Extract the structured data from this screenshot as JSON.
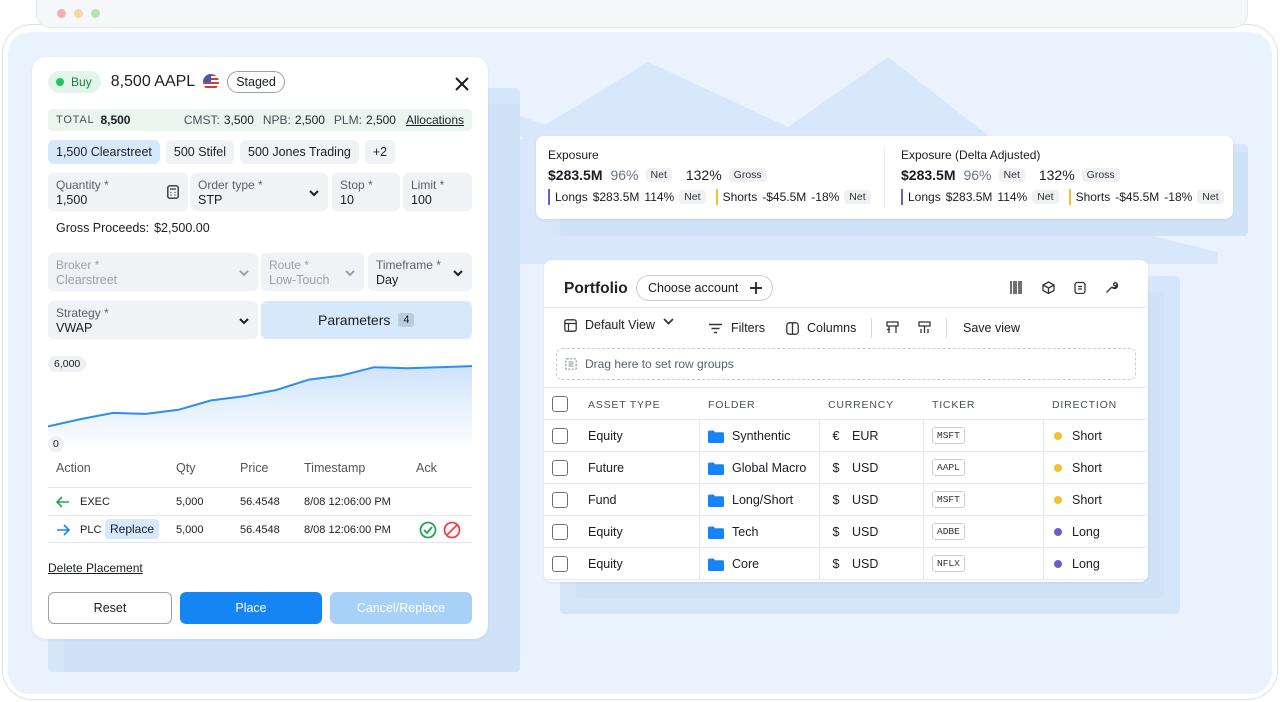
{
  "colors": {
    "accent": "#1685f4",
    "stage": "#eaf2fd",
    "green": "#22c55e",
    "red": "#ef4444",
    "long": "#6d5bd0",
    "short": "#f2c12e",
    "allocBg": "#e8f6ef"
  },
  "order": {
    "side": "Buy",
    "title": "8,500 AAPL",
    "status": "Staged",
    "total_label": "TOTAL",
    "total_value": "8,500",
    "allocs": [
      {
        "k": "CMST:",
        "v": "3,500"
      },
      {
        "k": "NPB:",
        "v": "2,500"
      },
      {
        "k": "PLM:",
        "v": "2,500"
      }
    ],
    "allocations_link": "Allocations",
    "brokers": [
      "1,500 Clearstreet",
      "500 Stifel",
      "500 Jones Trading",
      "+2"
    ],
    "quantity": {
      "label": "Quantity *",
      "value": "1,500"
    },
    "order_type": {
      "label": "Order type *",
      "value": "STP"
    },
    "stop": {
      "label": "Stop *",
      "value": "10"
    },
    "limit": {
      "label": "Limit *",
      "value": "100"
    },
    "gross_label": "Gross Proceeds:",
    "gross_value": "$2,500.00",
    "broker": {
      "label": "Broker *",
      "value": "Clearstreet"
    },
    "route": {
      "label": "Route *",
      "value": "Low-Touch"
    },
    "timeframe": {
      "label": "Timeframe *",
      "value": "Day"
    },
    "strategy": {
      "label": "Strategy *",
      "value": "VWAP"
    },
    "parameters_label": "Parameters",
    "parameters_count": "4",
    "chart_top": "6,000",
    "chart_bottom": "0",
    "exec_headers": [
      "Action",
      "Qty",
      "Price",
      "Timestamp",
      "Ack"
    ],
    "exec_rows": [
      {
        "action": "EXEC",
        "tag": "",
        "qty": "5,000",
        "price": "56.4548",
        "ts": "8/08 12:06:00 PM"
      },
      {
        "action": "PLC",
        "tag": "Replace",
        "qty": "5,000",
        "price": "56.4548",
        "ts": "8/08 12:06:00 PM"
      }
    ],
    "delete_link": "Delete Placement",
    "reset": "Reset",
    "place": "Place",
    "cancel_replace": "Cancel/Replace"
  },
  "chart_data": {
    "type": "area",
    "ylim": [
      0,
      6000
    ],
    "y_tick_labels": [
      "6,000",
      "0"
    ],
    "values": [
      1600,
      2300,
      2900,
      2800,
      3200,
      4100,
      4500,
      5100,
      6100,
      6500,
      7300,
      7200,
      7300,
      7400
    ]
  },
  "exposure": [
    {
      "title": "Exposure",
      "amount": "$283.5M",
      "pct": "96%",
      "net": "Net",
      "gross_pct": "132%",
      "gross": "Gross",
      "longs_label": "Longs",
      "longs_amt": "$283.5M",
      "longs_pct": "114%",
      "longs_tag": "Net",
      "shorts_label": "Shorts",
      "shorts_amt": "-$45.5M",
      "shorts_pct": "-18%",
      "shorts_tag": "Net"
    },
    {
      "title": "Exposure (Delta Adjusted)",
      "amount": "$283.5M",
      "pct": "96%",
      "net": "Net",
      "gross_pct": "132%",
      "gross": "Gross",
      "longs_label": "Longs",
      "longs_amt": "$283.5M",
      "longs_pct": "114%",
      "longs_tag": "Net",
      "shorts_label": "Shorts",
      "shorts_amt": "-$45.5M",
      "shorts_pct": "-18%",
      "shorts_tag": "Net"
    }
  ],
  "portfolio": {
    "title": "Portfolio",
    "choose_account": "Choose account",
    "default_view": "Default View",
    "filters": "Filters",
    "columns": "Columns",
    "save_view": "Save view",
    "drag_hint": "Drag here to set row groups",
    "headers": [
      "ASSET TYPE",
      "FOLDER",
      "CURRENCY",
      "TICKER",
      "DIRECTION"
    ],
    "rows": [
      {
        "asset": "Equity",
        "folder": "Synthentic",
        "cur_sym": "€",
        "cur": "EUR",
        "ticker": "MSFT",
        "dir": "Short"
      },
      {
        "asset": "Future",
        "folder": "Global Macro",
        "cur_sym": "$",
        "cur": "USD",
        "ticker": "AAPL",
        "dir": "Short"
      },
      {
        "asset": "Fund",
        "folder": "Long/Short",
        "cur_sym": "$",
        "cur": "USD",
        "ticker": "MSFT",
        "dir": "Short"
      },
      {
        "asset": "Equity",
        "folder": "Tech",
        "cur_sym": "$",
        "cur": "USD",
        "ticker": "ADBE",
        "dir": "Long"
      },
      {
        "asset": "Equity",
        "folder": "Core",
        "cur_sym": "$",
        "cur": "USD",
        "ticker": "NFLX",
        "dir": "Long"
      }
    ]
  }
}
